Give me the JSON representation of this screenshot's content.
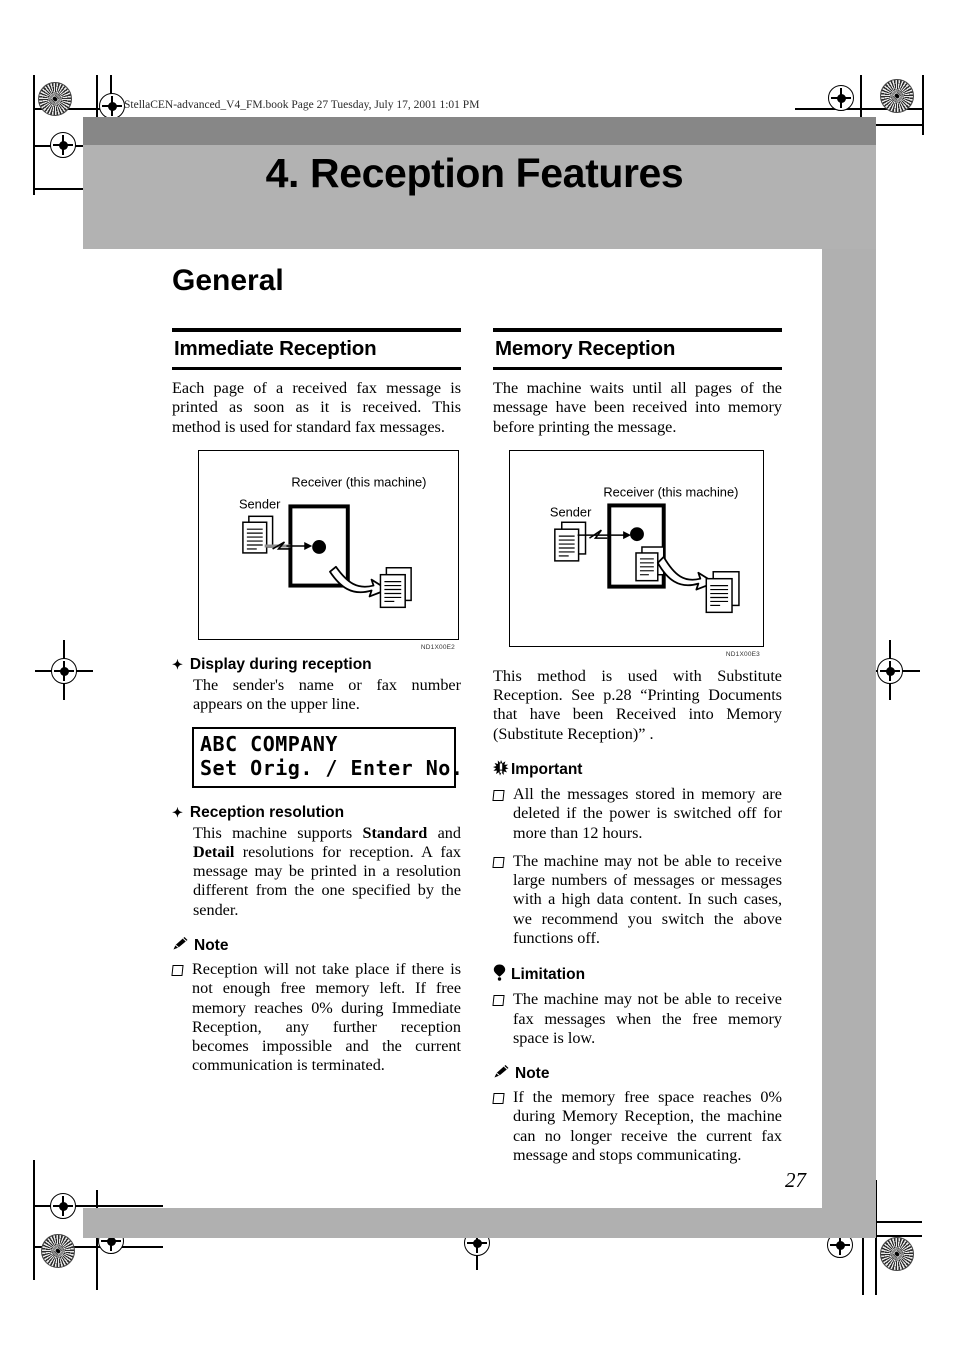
{
  "page": {
    "file_header": "StellaCEN-advanced_V4_FM.book  Page 27  Tuesday, July 17, 2001  1:01 PM",
    "chapter_title": "4. Reception Features",
    "general_heading": "General",
    "page_number": "27"
  },
  "left_column": {
    "section_heading": "Immediate Reception",
    "intro": "Each page of a received fax message is printed as soon as it is received. This method is used for standard fax messages.",
    "figure": {
      "code": "ND1X00E2",
      "sender_label": "Sender",
      "receiver_label": "Receiver (this machine)"
    },
    "display_block": {
      "heading": "Display during reception",
      "text": "The sender's name or fax number appears on the upper line."
    },
    "lcd": {
      "line1": "ABC COMPANY",
      "line2": "Set Orig. / Enter No."
    },
    "resolution_block": {
      "heading": "Reception resolution",
      "text_part1": "This machine supports ",
      "bold1": "Standard",
      "text_part2": " and ",
      "bold2": "Detail",
      "text_part3": " resolutions for reception. A fax message may be printed in a resolution different from the one specified by the sender."
    },
    "note": {
      "title": "Note",
      "items": [
        "Reception will not take place if there is not enough free memory left. If free memory reaches 0% during Immediate Reception, any further reception becomes impossible and the current communication is terminated."
      ]
    }
  },
  "right_column": {
    "section_heading": "Memory Reception",
    "intro": "The machine waits until all pages of the message have been received into memory before printing the message.",
    "figure": {
      "code": "ND1X00E3",
      "sender_label": "Sender",
      "receiver_label": "Receiver (this machine)"
    },
    "substitute_text": "This method is used with Substitute Reception. See p.28 “Printing Documents that have been Received into Memory (Substitute Reception)” .",
    "important": {
      "title": "Important",
      "items": [
        "All the messages stored in memory are deleted if the power is switched off for more than 12 hours.",
        "The machine may not be able to receive large numbers of messages or messages with a high data content. In such cases, we recommend you switch the above functions off."
      ]
    },
    "limitation": {
      "title": "Limitation",
      "items": [
        "The machine may not be able to receive fax messages when the free memory space is low."
      ]
    },
    "note": {
      "title": "Note",
      "items": [
        "If the memory free space reaches 0% during Memory Reception, the machine can no longer receive the current fax message and stops communicating."
      ]
    }
  },
  "colors": {
    "band_dark": "#878787",
    "band_light": "#b2b2b2",
    "page_shadow": "#b0b0b0"
  }
}
